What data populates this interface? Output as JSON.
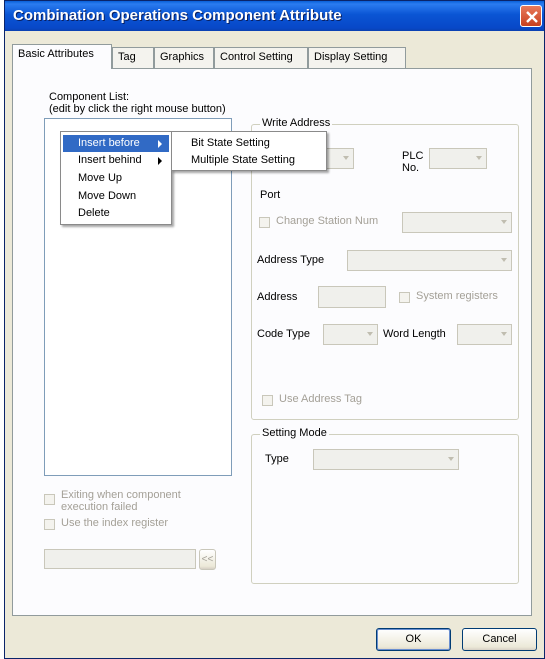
{
  "window": {
    "title": "Combination Operations Component Attribute"
  },
  "tabs": [
    "Basic Attributes",
    "Tag",
    "Graphics",
    "Control Setting",
    "Display Setting"
  ],
  "component_list": {
    "label_line1": "Component List:",
    "label_line2": "(edit by click the right mouse button)"
  },
  "context_menu": {
    "items": [
      "Insert before",
      "Insert behind",
      "Move Up",
      "Move Down",
      "Delete"
    ],
    "selected_index": 0,
    "submenu": [
      "Bit State Setting",
      "Multiple State Setting"
    ]
  },
  "left_options": {
    "exiting_line1": "Exiting when component",
    "exiting_line2": "execution failed",
    "use_index_register": "Use the index register",
    "browse_button": "<<"
  },
  "write_address": {
    "group_title": "Write Address",
    "plc_no_line1": "PLC",
    "plc_no_line2": "No.",
    "port": "Port",
    "change_station": "Change Station Num",
    "address_type": "Address Type",
    "address": "Address",
    "system_registers": "System registers",
    "code_type": "Code Type",
    "word_length": "Word Length",
    "use_address_tag": "Use Address Tag"
  },
  "setting_mode": {
    "group_title": "Setting Mode",
    "type": "Type"
  },
  "buttons": {
    "ok": "OK",
    "cancel": "Cancel"
  }
}
